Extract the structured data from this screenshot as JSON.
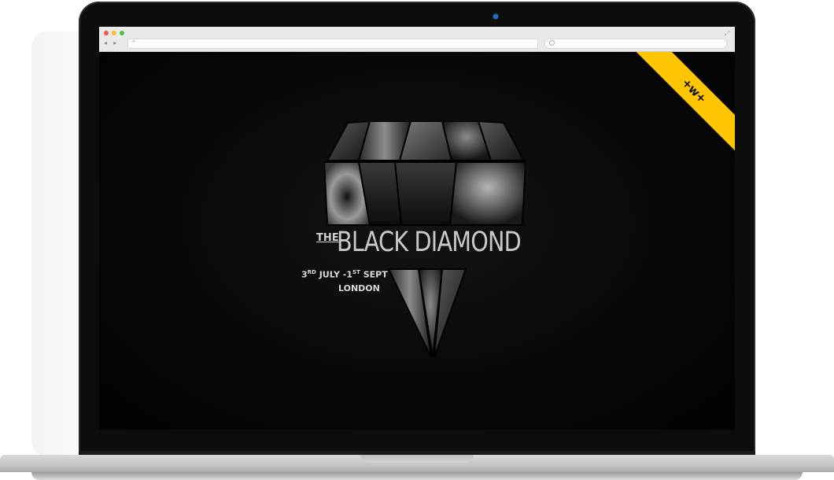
{
  "browser": {
    "address_placeholder": "+",
    "nav": "◂ ▸"
  },
  "ribbon": {
    "logo": "+w+",
    "color": "#ffc500"
  },
  "site": {
    "title_prefix": "THE",
    "title": "BLACK DIAMOND",
    "dates_start_day": "3",
    "dates_start_suffix": "RD",
    "dates_start_month": " JULY -1",
    "dates_end_suffix": "ST",
    "dates_end_month": " SEPT",
    "city": "LONDON"
  }
}
